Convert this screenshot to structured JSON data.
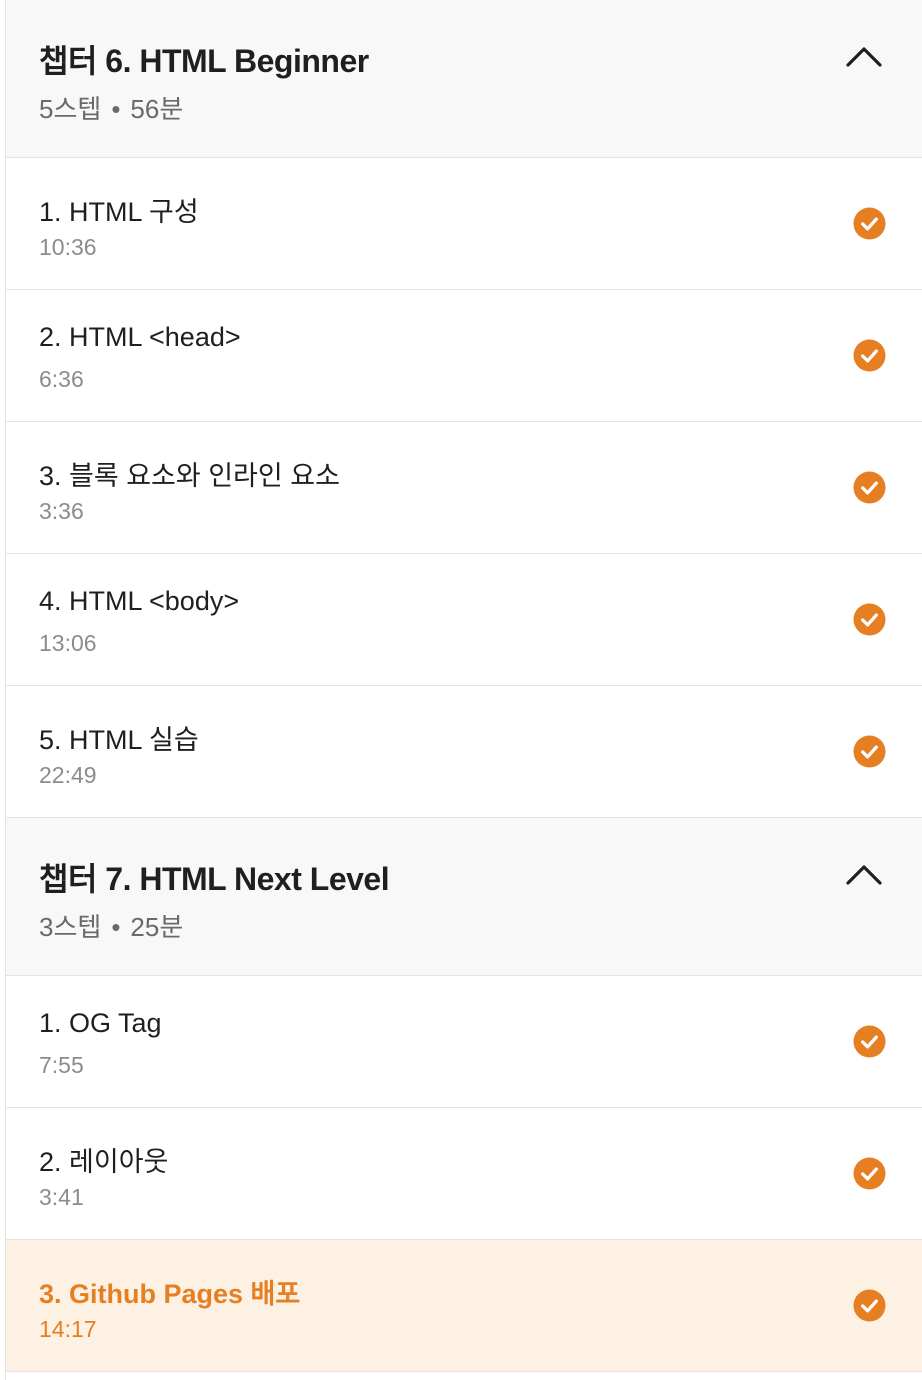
{
  "colors": {
    "accent": "#e67e22",
    "header_bg": "#f8f8f8",
    "active_bg": "#fdf1e4",
    "divider": "#e3e3e3"
  },
  "chapters": [
    {
      "title": "챕터 6. HTML Beginner",
      "steps": "5스텝",
      "separator": "•",
      "duration": "56분",
      "toggle_icon": "chevron-up-icon",
      "lessons": [
        {
          "title": "1. HTML 구성",
          "duration": "10:36",
          "completed": true
        },
        {
          "title": "2. HTML <head>",
          "duration": "6:36",
          "completed": true
        },
        {
          "title": "3. 블록 요소와 인라인 요소",
          "duration": "3:36",
          "completed": true
        },
        {
          "title": "4. HTML <body>",
          "duration": "13:06",
          "completed": true
        },
        {
          "title": "5. HTML 실습",
          "duration": "22:49",
          "completed": true
        }
      ]
    },
    {
      "title": "챕터 7. HTML Next Level",
      "steps": "3스텝",
      "separator": "•",
      "duration": "25분",
      "toggle_icon": "chevron-up-icon",
      "lessons": [
        {
          "title": "1. OG Tag",
          "duration": "7:55",
          "completed": true
        },
        {
          "title": "2. 레이아웃",
          "duration": "3:41",
          "completed": true
        },
        {
          "title": "3. Github Pages 배포",
          "duration": "14:17",
          "completed": true,
          "active": true
        }
      ]
    }
  ]
}
